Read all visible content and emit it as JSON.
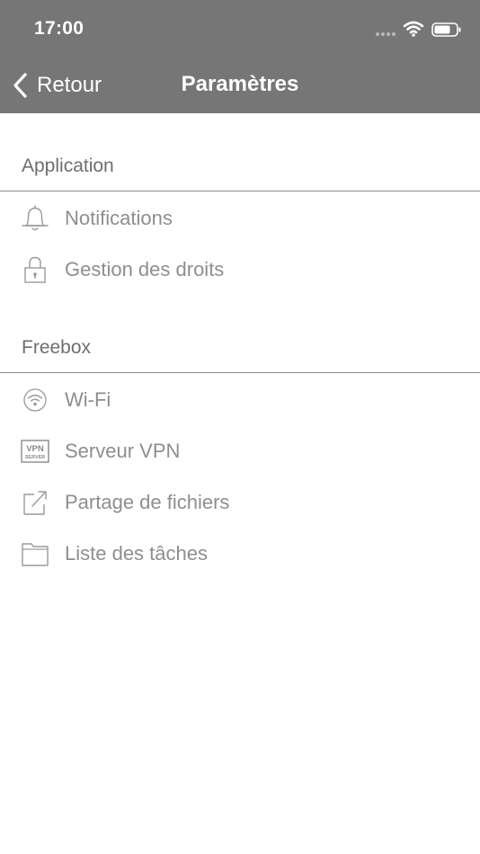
{
  "status_bar": {
    "time": "17:00"
  },
  "nav": {
    "back_label": "Retour",
    "title": "Paramètres"
  },
  "sections": [
    {
      "title": "Application",
      "items": [
        {
          "label": "Notifications",
          "icon": "bell-icon"
        },
        {
          "label": "Gestion des droits",
          "icon": "lock-icon"
        }
      ]
    },
    {
      "title": "Freebox",
      "items": [
        {
          "label": "Wi-Fi",
          "icon": "wifi-icon"
        },
        {
          "label": "Serveur VPN",
          "icon": "vpn-server-icon",
          "icon_text_top": "VPN",
          "icon_text_bottom": "SERVER"
        },
        {
          "label": "Partage de fichiers",
          "icon": "share-edit-icon"
        },
        {
          "label": "Liste des tâches",
          "icon": "folder-icon"
        }
      ]
    }
  ],
  "colors": {
    "header_bg": "#767676",
    "header_text": "#ffffff",
    "section_text": "#6e6e6e",
    "item_text": "#8e8e8e",
    "icon_stroke": "#9a9a9a",
    "divider": "#8a8a8a"
  }
}
